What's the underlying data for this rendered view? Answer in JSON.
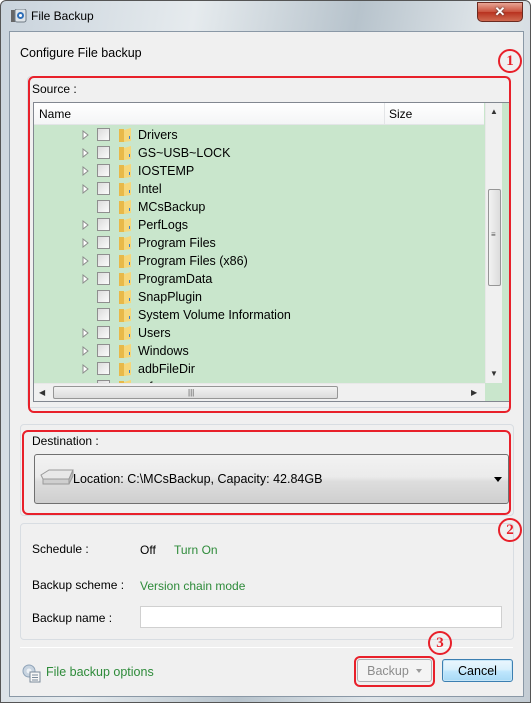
{
  "window": {
    "title": "File Backup",
    "close_icon": "close-icon",
    "app_icon": "file-backup-app-icon"
  },
  "heading": "Configure File backup",
  "annotations": [
    "1",
    "2",
    "3"
  ],
  "source": {
    "label": "Source :",
    "columns": {
      "name": "Name",
      "size": "Size"
    },
    "items": [
      {
        "name": "Drivers",
        "expandable": true,
        "checked": false
      },
      {
        "name": "GS~USB~LOCK",
        "expandable": true,
        "checked": false
      },
      {
        "name": "IOSTEMP",
        "expandable": true,
        "checked": false
      },
      {
        "name": "Intel",
        "expandable": true,
        "checked": false
      },
      {
        "name": "MCsBackup",
        "expandable": false,
        "checked": false
      },
      {
        "name": "PerfLogs",
        "expandable": true,
        "checked": false
      },
      {
        "name": "Program Files",
        "expandable": true,
        "checked": false
      },
      {
        "name": "Program Files (x86)",
        "expandable": true,
        "checked": false
      },
      {
        "name": "ProgramData",
        "expandable": true,
        "checked": false
      },
      {
        "name": "SnapPlugin",
        "expandable": false,
        "checked": false
      },
      {
        "name": "System Volume Information",
        "expandable": false,
        "checked": false
      },
      {
        "name": "Users",
        "expandable": true,
        "checked": false
      },
      {
        "name": "Windows",
        "expandable": true,
        "checked": false
      },
      {
        "name": "adbFileDir",
        "expandable": true,
        "checked": false
      },
      {
        "name": "arf...",
        "expandable": false,
        "checked": false
      }
    ]
  },
  "destination": {
    "label": "Destination :",
    "value": "Location: C:\\MCsBackup, Capacity: 42.84GB"
  },
  "schedule": {
    "label": "Schedule :",
    "value": "Off",
    "action": "Turn On"
  },
  "scheme": {
    "label": "Backup scheme :",
    "value": "Version chain mode"
  },
  "backup_name": {
    "label": "Backup name :",
    "value": ""
  },
  "footer": {
    "options_link": "File backup options",
    "backup_button": "Backup",
    "cancel_button": "Cancel"
  },
  "colors": {
    "accent_link": "#2e8b3a",
    "tree_background": "#c9e6cc",
    "annotation_red": "#e8202a"
  }
}
